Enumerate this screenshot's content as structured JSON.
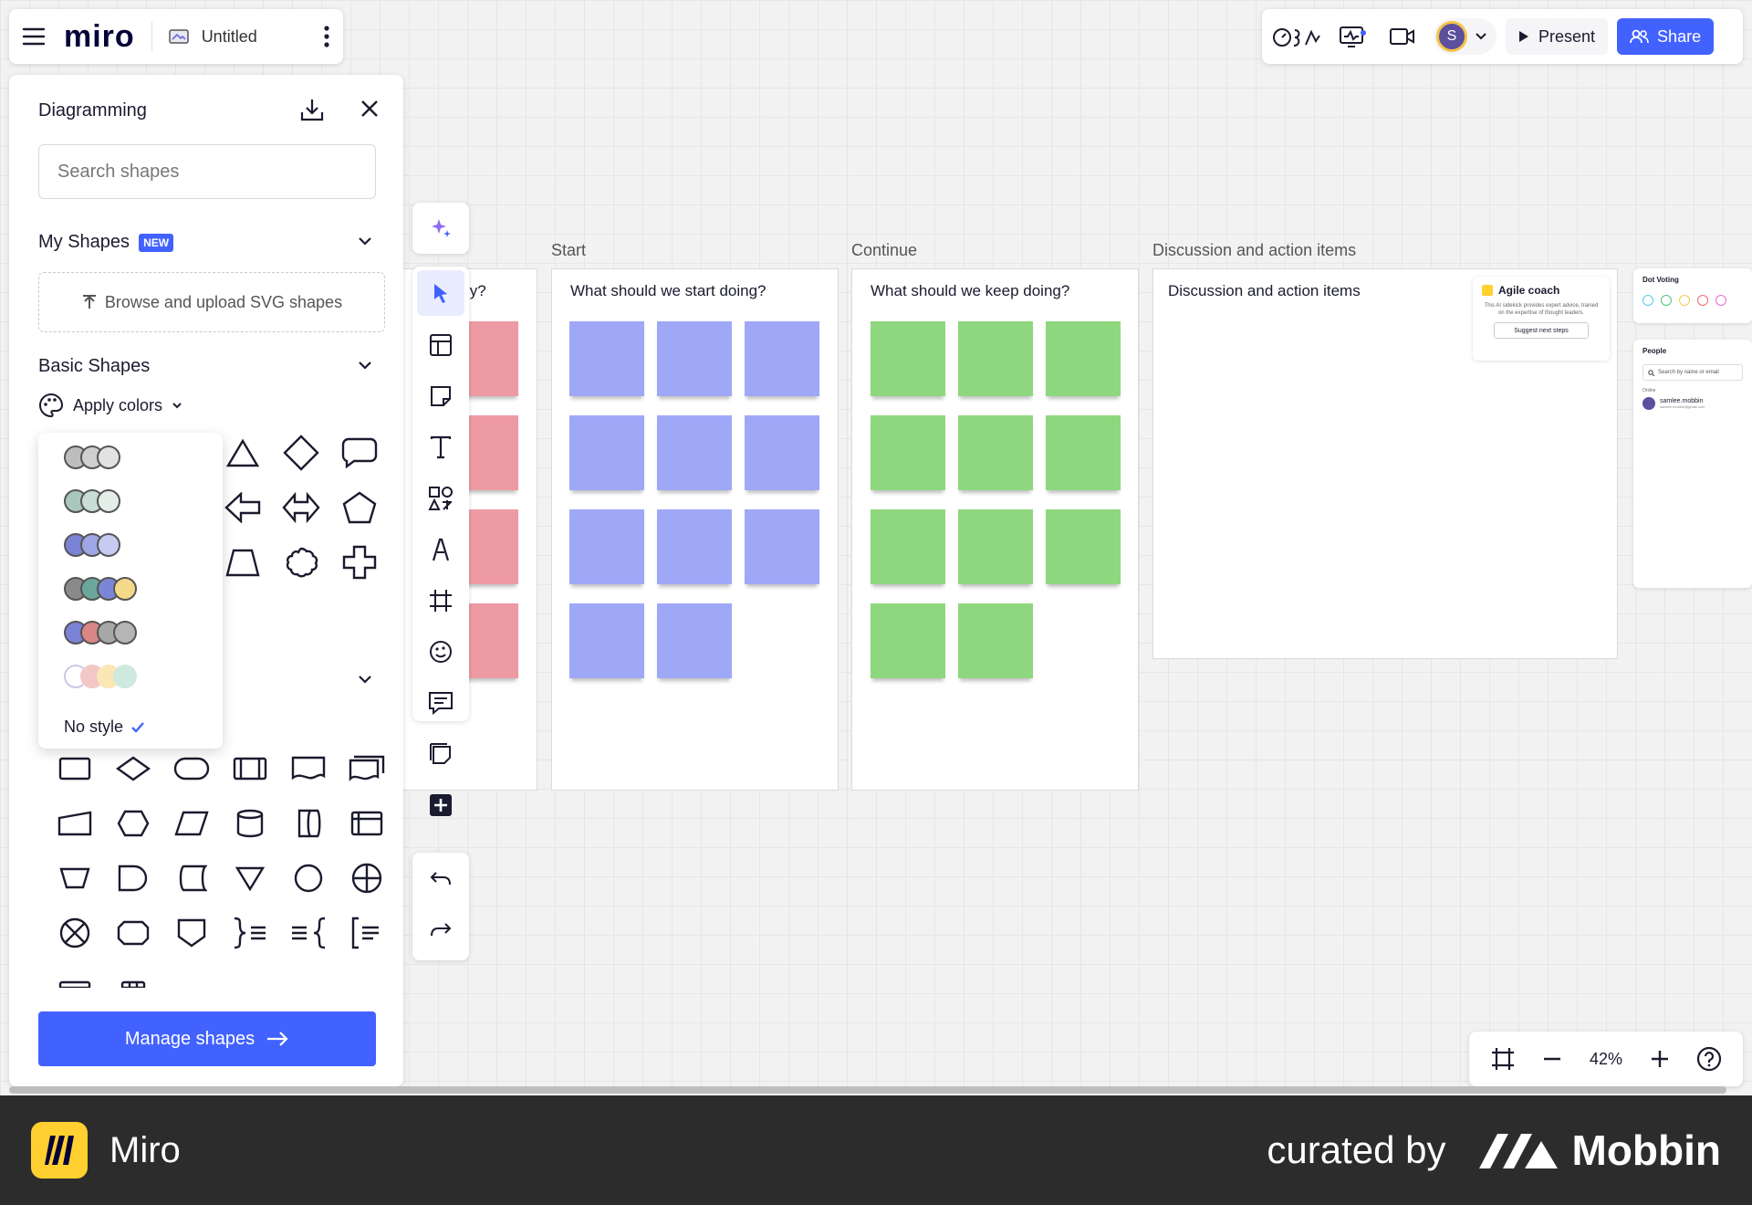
{
  "app": {
    "brand": "miro",
    "board_name": "Untitled"
  },
  "topbar": {
    "present_label": "Present",
    "share_label": "Share",
    "avatar_initial": "S"
  },
  "diagramming": {
    "title": "Diagramming",
    "search_placeholder": "Search shapes",
    "my_shapes": {
      "label": "My Shapes",
      "badge": "NEW"
    },
    "upload_label": "Browse and upload SVG shapes",
    "basic_shapes_label": "Basic Shapes",
    "apply_colors_label": "Apply colors",
    "manage_label": "Manage shapes"
  },
  "color_dropdown": {
    "palettes": [
      [
        "#bdbdbd",
        "#cfcfcf",
        "#e2e2e2"
      ],
      [
        "#a9c7bb",
        "#c8ddd4",
        "#e3eee9"
      ],
      [
        "#7b83d6",
        "#9fa6e6",
        "#c6cbf2"
      ],
      [
        "#8a8a8a",
        "#6ba69a",
        "#7c86d6",
        "#f4d98a"
      ],
      [
        "#7b83d6",
        "#d98686",
        "#a7a7a7",
        "#b5b5b5"
      ],
      [
        "#ffffff",
        "#f4c7c7",
        "#fbe6b5",
        "#cfe9df"
      ]
    ],
    "no_style_label": "No style"
  },
  "frames": {
    "partial": {
      "question": "ly?"
    },
    "start": {
      "label": "Start",
      "question": "What should we start doing?"
    },
    "continue": {
      "label": "Continue",
      "question": "What should we keep doing?"
    },
    "discussion": {
      "label": "Discussion and action items",
      "question": "Discussion and action items"
    }
  },
  "agile_coach": {
    "title": "Agile coach",
    "description": "This AI sidekick provides expert advice, trained on the expertise of thought leaders.",
    "button_label": "Suggest next steps"
  },
  "side_widgets": {
    "dot_voting_label": "Dot Voting",
    "people_label": "People",
    "people_search_placeholder": "Search by name or email",
    "online_label": "Online",
    "person_name": "samlee.mobbin",
    "person_email": "samlee.mobbin@gmail.com"
  },
  "zoom": {
    "value": "42%"
  },
  "footer": {
    "app_name": "Miro",
    "curated_by": "curated by",
    "brand": "Mobbin"
  },
  "colors": {
    "accent": "#4262ff",
    "sticky_blue": "#9fa8f7",
    "sticky_green": "#8fd77e",
    "sticky_pink": "#ee9aa4",
    "footer_bg": "#2c2c2c"
  }
}
